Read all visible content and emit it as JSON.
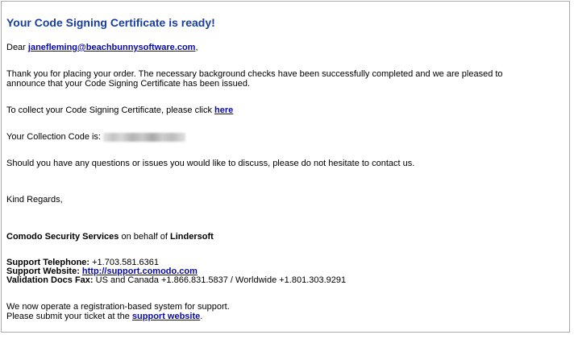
{
  "email": {
    "headline": "Your Code Signing Certificate is ready!",
    "greeting_prefix": "Dear ",
    "recipient_email": "janefleming@beachbunnysoftware.com",
    "greeting_suffix": ",",
    "paragraph1_line1": "Thank you for placing your order. The necessary background checks have been successfully completed and we are pleased to",
    "paragraph1_line2": "announce that your Code Signing Certificate has been issued.",
    "collect_prefix": "To collect your Code Signing Certificate, please click ",
    "collect_link": "here",
    "collection_code_label": "Your Collection Code is:",
    "questions_text": "Should you have any questions or issues you would like to discuss, please do not hesitate to contact us.",
    "closing": "Kind Regards,",
    "signature_company": "Comodo Security Services",
    "signature_middle": " on behalf of ",
    "signature_client": "Lindersoft",
    "support_phone_label": "Support Telephone:",
    "support_phone_value": " +1.703.581.6361",
    "support_website_label": "Support Website:",
    "support_website_link": "http://support.comodo.com",
    "validation_fax_label": "Validation Docs Fax:",
    "validation_fax_value": " US and Canada +1.866.831.5837 / Worldwide +1.801.303.9291",
    "registration_notice": "We now operate a registration-based system for support.",
    "submit_ticket_prefix": "Please submit your ticket at the ",
    "submit_ticket_link": "support website",
    "submit_ticket_suffix": "."
  },
  "colors": {
    "headline": "#1a3f99",
    "link": "#0b0b9a",
    "border": "#a9a9a9"
  }
}
